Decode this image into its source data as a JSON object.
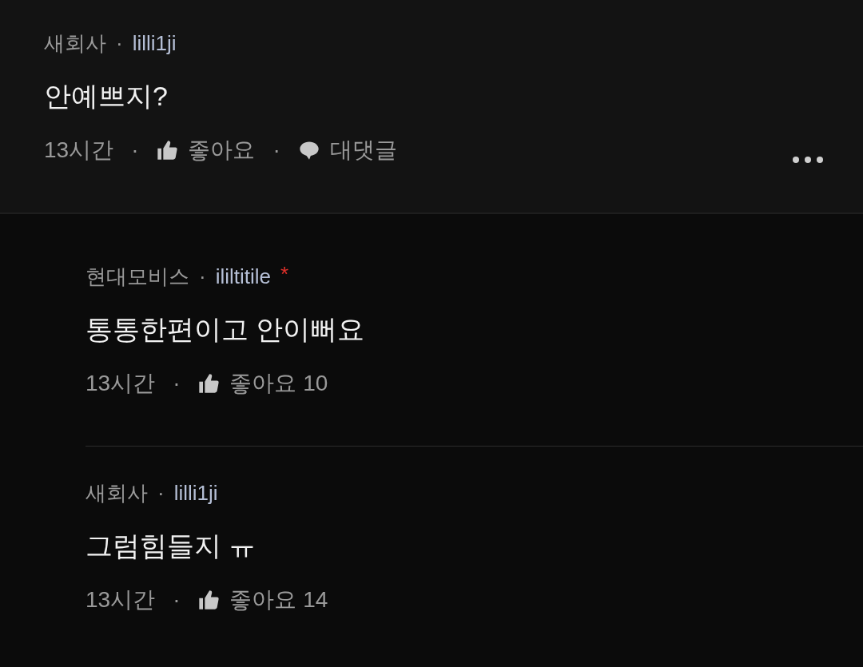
{
  "comment": {
    "author": "새회사",
    "author_separator": "·",
    "username": "lilli1ji",
    "body": "안예쁘지?",
    "meta": [
      {
        "kind": "time",
        "text": "13시간"
      },
      {
        "kind": "separator",
        "text": "·"
      },
      {
        "kind": "like",
        "text": "좋아요"
      },
      {
        "kind": "separator",
        "text": "·"
      },
      {
        "kind": "reply",
        "text": "대댓글"
      }
    ],
    "has_more_menu": true
  },
  "replies": [
    {
      "author": "현대모비스",
      "author_separator": "·",
      "username": "ililtitile",
      "badge": "*",
      "body": "통통한편이고 안이뻐요",
      "meta": [
        {
          "kind": "time",
          "text": "13시간"
        },
        {
          "kind": "separator",
          "text": "·"
        },
        {
          "kind": "like",
          "text": "좋아요",
          "count": "10"
        }
      ]
    },
    {
      "author": "새회사",
      "author_separator": "·",
      "username": "lilli1ji",
      "body": "그럼힘들지 ㅠ",
      "meta": [
        {
          "kind": "time",
          "text": "13시간"
        },
        {
          "kind": "separator",
          "text": "·"
        },
        {
          "kind": "like",
          "text": "좋아요",
          "count": "14"
        }
      ]
    }
  ]
}
